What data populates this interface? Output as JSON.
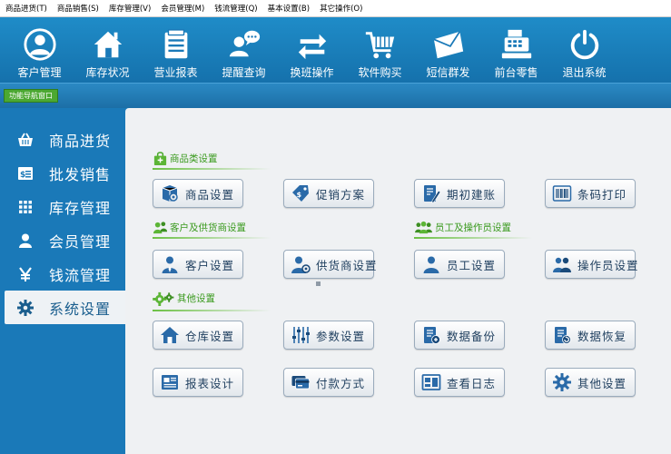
{
  "menubar": {
    "items": [
      "商品进货(T)",
      "商品销售(S)",
      "库存管理(V)",
      "会员管理(M)",
      "钱流管理(Q)",
      "基本设置(B)",
      "其它操作(O)"
    ]
  },
  "toolbar": {
    "items": [
      {
        "label": "客户管理",
        "icon": "user-circle-icon"
      },
      {
        "label": "库存状况",
        "icon": "house-icon"
      },
      {
        "label": "营业报表",
        "icon": "report-list-icon"
      },
      {
        "label": "提醒查询",
        "icon": "chat-person-icon"
      },
      {
        "label": "换班操作",
        "icon": "exchange-arrows-icon"
      },
      {
        "label": "软件购买",
        "icon": "cart-icon"
      },
      {
        "label": "短信群发",
        "icon": "envelope-icon"
      },
      {
        "label": "前台零售",
        "icon": "cash-register-icon"
      },
      {
        "label": "退出系统",
        "icon": "power-icon"
      }
    ]
  },
  "nav": {
    "tag": "功能导航窗口"
  },
  "sidebar": {
    "items": [
      {
        "label": "商品进货",
        "icon": "basket-icon"
      },
      {
        "label": "批发销售",
        "icon": "price-tag-icon"
      },
      {
        "label": "库存管理",
        "icon": "grid-icon"
      },
      {
        "label": "会员管理",
        "icon": "person-icon"
      },
      {
        "label": "钱流管理",
        "icon": "yen-icon"
      },
      {
        "label": "系统设置",
        "icon": "gear-icon"
      }
    ],
    "active_index": 5
  },
  "main": {
    "sections": {
      "goods": "商品类设置",
      "customer": "客户及供货商设置",
      "staff": "员工及操作员设置",
      "other": "其他设置"
    },
    "buttons": {
      "goods_setting": "商品设置",
      "promotion": "促销方案",
      "initial_account": "期初建账",
      "barcode_print": "条码打印",
      "customer_setting": "客户设置",
      "supplier_setting": "供货商设置",
      "employee_setting": "员工设置",
      "operator_setting": "操作员设置",
      "warehouse_setting": "仓库设置",
      "param_setting": "参数设置",
      "data_backup": "数据备份",
      "data_restore": "数据恢复",
      "report_design": "报表设计",
      "payment_method": "付款方式",
      "view_log": "查看日志",
      "other_setting": "其他设置"
    }
  },
  "colors": {
    "primary_blue": "#1a79b8",
    "accent_green": "#3a9a1e",
    "panel_bg": "#eff1f3",
    "button_text": "#1e3e5e"
  }
}
